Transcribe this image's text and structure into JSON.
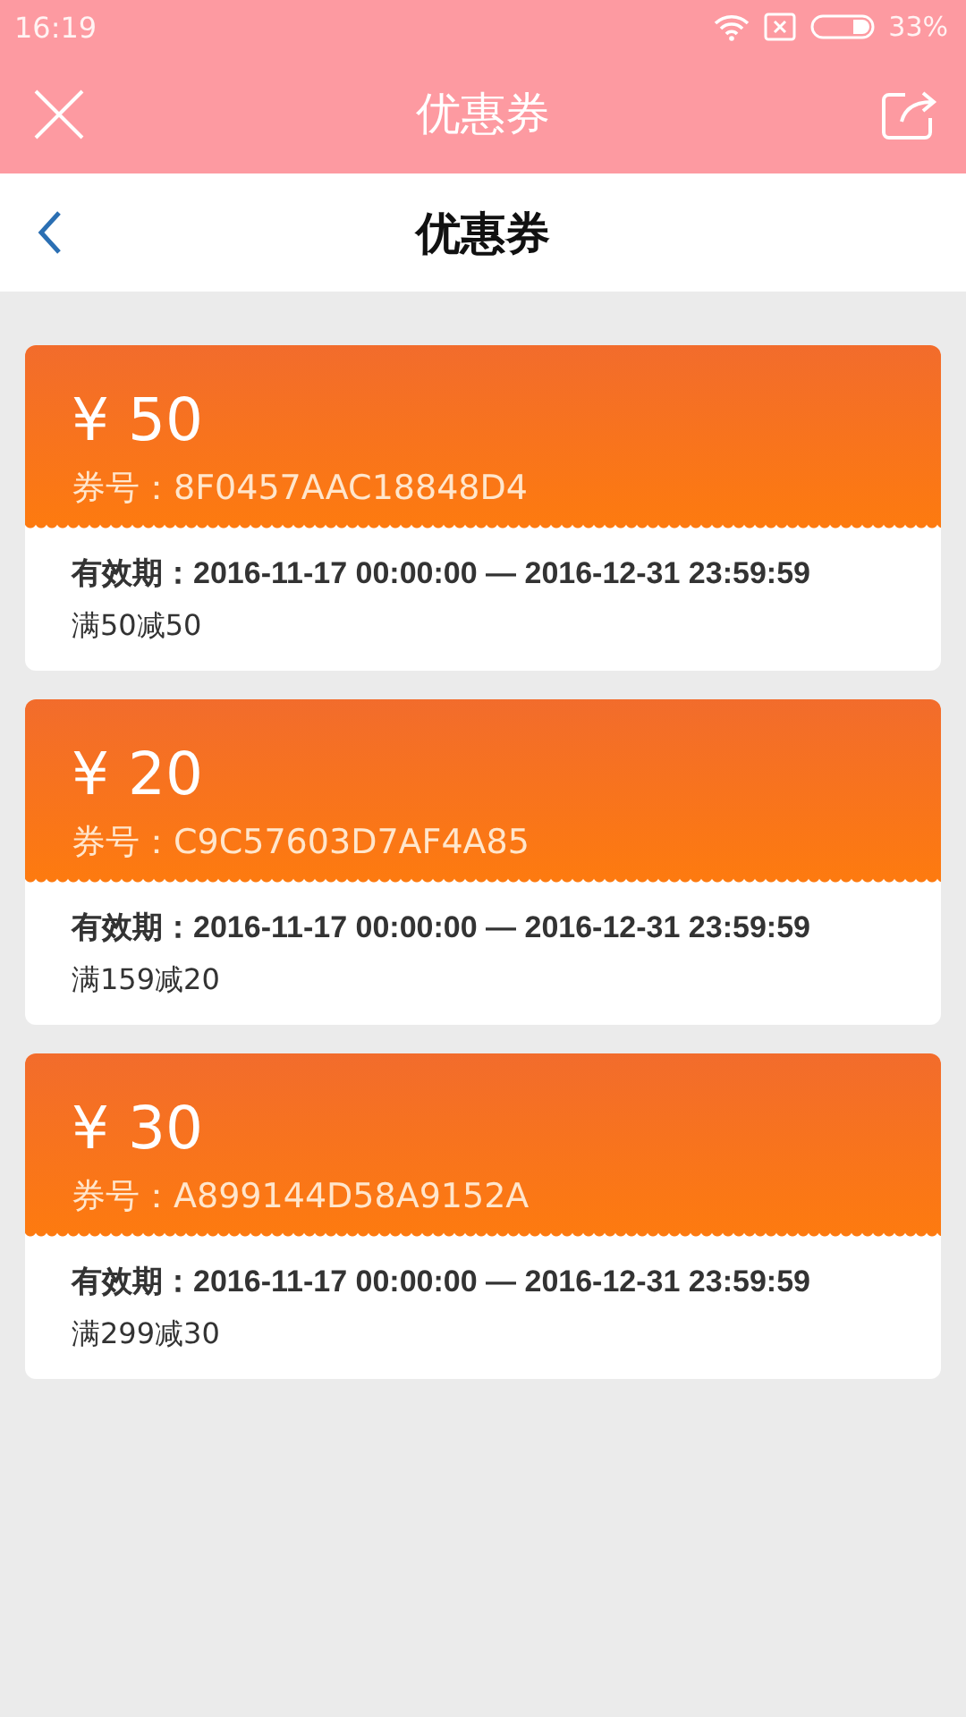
{
  "status_bar": {
    "time": "16:19",
    "battery": "33%"
  },
  "app_bar": {
    "title": "优惠券"
  },
  "nav_bar": {
    "title": "优惠券"
  },
  "coupons": [
    {
      "amount": "¥ 50",
      "code": "券号：8F0457AAC18848D4",
      "validity": "有效期：2016-11-17 00:00:00 — 2016-12-31 23:59:59",
      "condition": "满50减50"
    },
    {
      "amount": "¥ 20",
      "code": "券号：C9C57603D7AF4A85",
      "validity": "有效期：2016-11-17 00:00:00 — 2016-12-31 23:59:59",
      "condition": "满159减20"
    },
    {
      "amount": "¥ 30",
      "code": "券号：A899144D58A9152A",
      "validity": "有效期：2016-11-17 00:00:00 — 2016-12-31 23:59:59",
      "condition": "满299减30"
    }
  ]
}
